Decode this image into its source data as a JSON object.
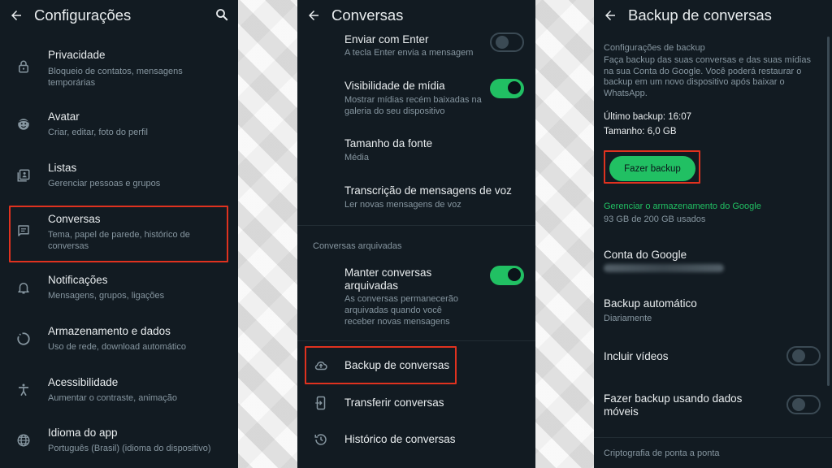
{
  "screen1": {
    "title": "Configurações",
    "items": [
      {
        "label": "Privacidade",
        "sub": "Bloqueio de contatos, mensagens temporárias",
        "icon": "lock-icon"
      },
      {
        "label": "Avatar",
        "sub": "Criar, editar, foto do perfil",
        "icon": "avatar-icon"
      },
      {
        "label": "Listas",
        "sub": "Gerenciar pessoas e grupos",
        "icon": "lists-icon"
      },
      {
        "label": "Conversas",
        "sub": "Tema, papel de parede, histórico de conversas",
        "icon": "chat-icon"
      },
      {
        "label": "Notificações",
        "sub": "Mensagens, grupos, ligações",
        "icon": "bell-icon"
      },
      {
        "label": "Armazenamento e dados",
        "sub": "Uso de rede, download automático",
        "icon": "storage-icon"
      },
      {
        "label": "Acessibilidade",
        "sub": "Aumentar o contraste, animação",
        "icon": "accessibility-icon"
      },
      {
        "label": "Idioma do app",
        "sub": "Português (Brasil) (idioma do dispositivo)",
        "icon": "globe-icon"
      }
    ]
  },
  "screen2": {
    "title": "Conversas",
    "items": [
      {
        "label": "Enviar com Enter",
        "sub": "A tecla Enter envia a mensagem",
        "toggle": "off"
      },
      {
        "label": "Visibilidade de mídia",
        "sub": "Mostrar mídias recém baixadas na galeria do seu dispositivo",
        "toggle": "on"
      },
      {
        "label": "Tamanho da fonte",
        "sub": "Média"
      },
      {
        "label": "Transcrição de mensagens de voz",
        "sub": "Ler novas mensagens de voz"
      }
    ],
    "archived_section": "Conversas arquivadas",
    "archived_item": {
      "label": "Manter conversas arquivadas",
      "sub": "As conversas permanecerão arquivadas quando você receber novas mensagens",
      "toggle": "on"
    },
    "links": [
      {
        "label": "Backup de conversas",
        "icon": "cloud-upload-icon"
      },
      {
        "label": "Transferir conversas",
        "icon": "transfer-icon"
      },
      {
        "label": "Histórico de conversas",
        "icon": "history-icon"
      }
    ]
  },
  "screen3": {
    "title": "Backup de conversas",
    "section_title": "Configurações de backup",
    "description": "Faça backup das suas conversas e das suas mídias na sua Conta do Google. Você poderá restaurar o backup em um novo dispositivo após baixar o WhatsApp.",
    "last_backup": "Último backup: 16:07",
    "size": "Tamanho: 6,0 GB",
    "backup_button": "Fazer backup",
    "manage_storage": "Gerenciar o armazenamento do Google",
    "storage_used": "93 GB de 200 GB usados",
    "google_account_label": "Conta do Google",
    "auto_backup_label": "Backup automático",
    "auto_backup_value": "Diariamente",
    "include_videos_label": "Incluir vídeos",
    "include_videos_toggle": "off",
    "mobile_data_label": "Fazer backup usando dados móveis",
    "mobile_data_toggle": "off",
    "encryption_label": "Criptografia de ponta a ponta"
  },
  "colors": {
    "background": "#121b22",
    "accent_green": "#21c063",
    "highlight_red": "#e0321f",
    "primary_text": "#e9edef",
    "secondary_text": "#8696a0"
  }
}
